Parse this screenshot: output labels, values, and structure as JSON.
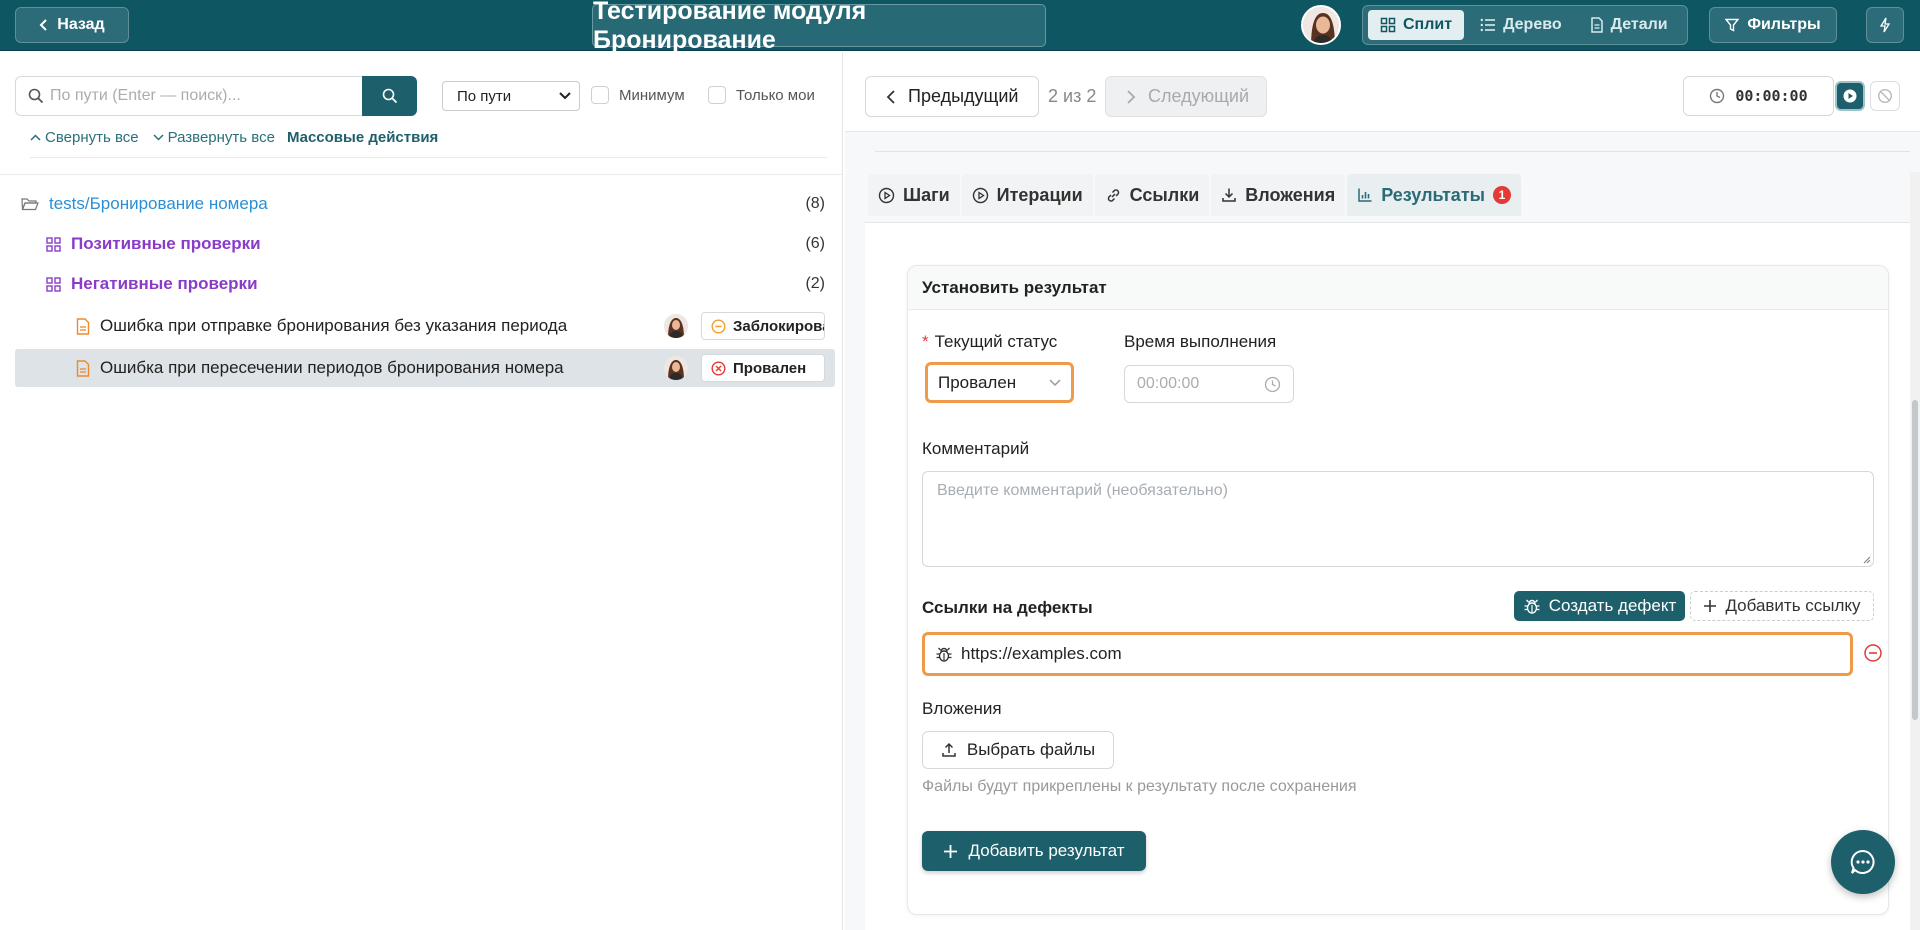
{
  "header": {
    "back_label": "Назад",
    "title": "Тестирование модуля Бронирование",
    "views": [
      {
        "label": "Сплит",
        "icon": "split-view-icon",
        "active": true
      },
      {
        "label": "Дерево",
        "icon": "list-tree-icon",
        "active": false
      },
      {
        "label": "Детали",
        "icon": "document-icon",
        "active": false
      }
    ],
    "filters_label": "Фильтры"
  },
  "left_panel": {
    "search": {
      "placeholder": "По пути (Enter — поиск)...",
      "value": ""
    },
    "sort_select": "По пути",
    "checkbox_minimum": "Минимум",
    "checkbox_only_mine": "Только мои",
    "collapse_all": "Свернуть все",
    "expand_all": "Развернуть все",
    "bulk_actions": "Массовые действия",
    "tree": [
      {
        "type": "folder",
        "label": "tests/Бронирование номера",
        "count": "(8)"
      },
      {
        "type": "suite",
        "label": "Позитивные проверки",
        "count": "(6)"
      },
      {
        "type": "suite",
        "label": "Негативные проверки",
        "count": "(2)"
      },
      {
        "type": "case",
        "label": "Ошибка при отправке бронирования без указания периода",
        "status": "Заблокирован",
        "status_icon": "minus-circle-icon"
      },
      {
        "type": "case",
        "label": "Ошибка при пересечении периодов бронирования номера",
        "status": "Провален",
        "status_icon": "x-circle-icon",
        "selected": true
      }
    ]
  },
  "right_panel": {
    "prev_label": "Предыдущий",
    "position": "2 из 2",
    "next_label": "Следующий",
    "timer": "00:00:00",
    "tabs": [
      {
        "label": "Шаги",
        "icon": "play-circle-icon"
      },
      {
        "label": "Итерации",
        "icon": "play-circle-icon"
      },
      {
        "label": "Ссылки",
        "icon": "link-icon"
      },
      {
        "label": "Вложения",
        "icon": "download-icon"
      },
      {
        "label": "Результаты",
        "icon": "bar-chart-icon",
        "badge": "1",
        "active": true
      }
    ],
    "form": {
      "title": "Установить результат",
      "status_label": "Текущий статус",
      "status_value": "Провален",
      "time_label": "Время выполнения",
      "time_placeholder": "00:00:00",
      "comment_label": "Комментарий",
      "comment_placeholder": "Введите комментарий (необязательно)",
      "defects_label": "Ссылки на дефекты",
      "create_defect": "Создать дефект",
      "add_link": "Добавить ссылку",
      "defect_url": "https://examples.com",
      "attachments_label": "Вложения",
      "choose_files": "Выбрать файлы",
      "attachments_hint": "Файлы будут прикреплены к результату после сохранения",
      "add_result": "Добавить результат"
    }
  },
  "colors": {
    "header_bg": "#0f5663",
    "primary": "#1d5f6b",
    "highlight_border": "#ef9a4a",
    "folder_link": "#2a8fd6",
    "suite": "#8a3cc9",
    "danger": "#e53935"
  }
}
